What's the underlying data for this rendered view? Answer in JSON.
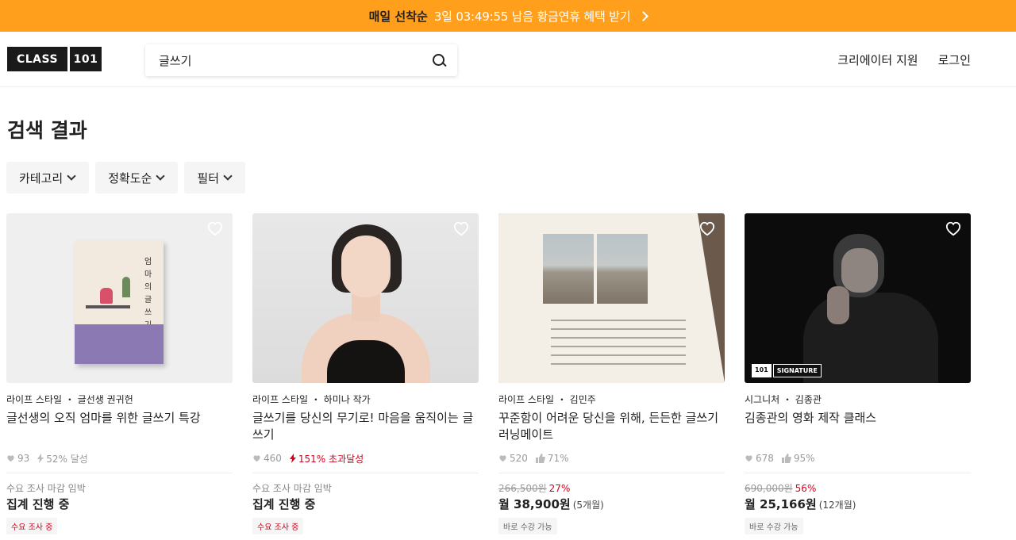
{
  "promo": {
    "prefix": "매일 선착순",
    "text": "3일 03:49:55 남음  황금연휴 혜택 받기"
  },
  "header": {
    "logo_left": "CLASS",
    "logo_right": "101",
    "search_value": "글쓰기",
    "nav": [
      "크리에이터 지원",
      "로그인"
    ]
  },
  "page_title": "검색 결과",
  "filters": [
    "카테고리",
    "정확도순",
    "필터"
  ],
  "cards": [
    {
      "category": "라이프 스타일 ・ 글선생 권귀헌",
      "title": "글선생의 오직 엄마를 위한 글쓰기 특강",
      "likes": "93",
      "rate": "52% 달성",
      "sub": "수요 조사 마감 임박",
      "main": "집계 진행 중",
      "badge": "수요 조사 중"
    },
    {
      "category": "라이프 스타일 ・ 하미나 작가",
      "title": "글쓰기를 당신의 무기로! 마음을 움직이는 글쓰기",
      "likes": "460",
      "rate": "151% 초과달성",
      "sub": "수요 조사 마감 임박",
      "main": "집계 진행 중",
      "badge": "수요 조사 중"
    },
    {
      "category": "라이프 스타일 ・ 김민주",
      "title": "꾸준함이 어려운 당신을 위해, 든든한 글쓰기 러닝메이트",
      "likes": "520",
      "rate": "71%",
      "original_price": "266,500원",
      "discount": "27%",
      "main": "월 38,900원",
      "months": "(5개월)",
      "badge": "바로 수강 가능"
    },
    {
      "category": "시그니처 ・ 김종관",
      "title": "김종관의 영화 제작 클래스",
      "likes": "678",
      "rate": "95%",
      "original_price": "690,000원",
      "discount": "56%",
      "main": "월 25,166원",
      "months": "(12개월)",
      "badge": "바로 수강 가능",
      "signature_label": "SIGNATURE",
      "signature_logo": "101"
    }
  ],
  "book": {
    "vertical_title": "엄마의 글쓰기"
  },
  "colors": {
    "promo_bg": "#ff9f1c",
    "accent_red": "#d6001c"
  }
}
